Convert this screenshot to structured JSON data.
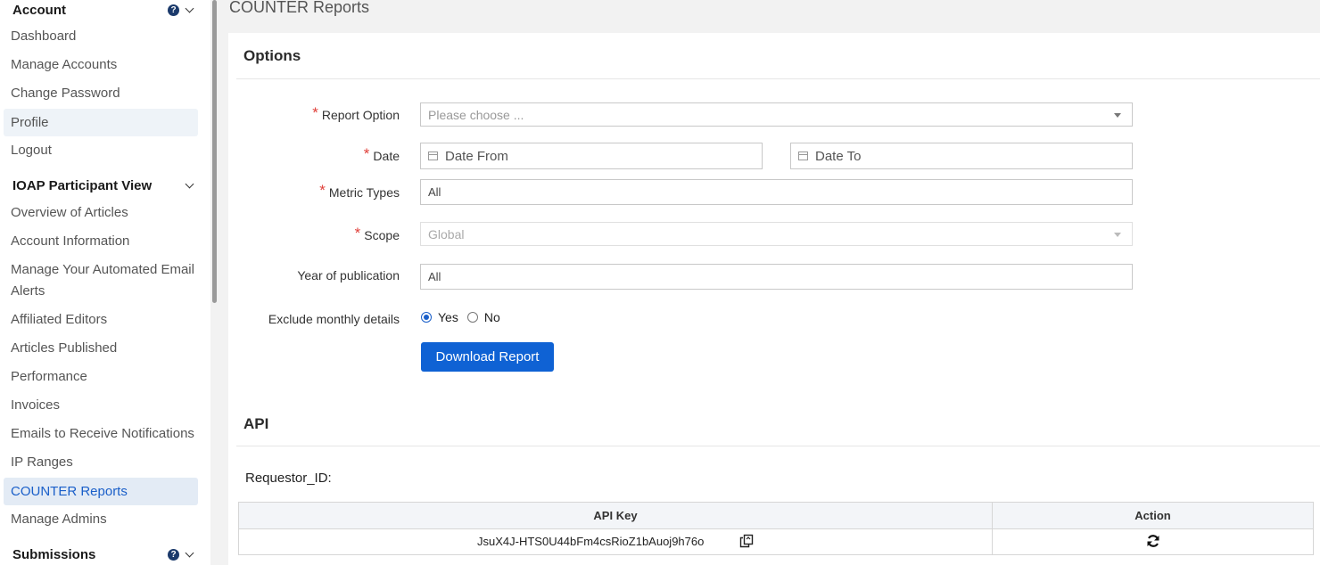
{
  "sidebar": {
    "account_header": "Account",
    "account_items": [
      "Dashboard",
      "Manage Accounts",
      "Change Password",
      "Profile",
      "Logout"
    ],
    "ioap_header": "IOAP Participant View",
    "ioap_items": [
      "Overview of Articles",
      "Account Information",
      "Manage Your Automated Email",
      "Alerts",
      "Affiliated Editors",
      "Articles Published",
      "Performance",
      "Invoices",
      "Emails to Receive Notifications",
      "IP Ranges",
      "COUNTER Reports",
      "Manage Admins"
    ],
    "submissions_header": "Submissions"
  },
  "page_title": "COUNTER Reports",
  "options": {
    "title": "Options",
    "report_option_label": "Report Option",
    "report_option_placeholder": "Please choose ...",
    "date_label": "Date",
    "date_from_placeholder": "Date From",
    "date_to_placeholder": "Date To",
    "metric_types_label": "Metric Types",
    "metric_types_value": "All",
    "scope_label": "Scope",
    "scope_value": "Global",
    "year_label": "Year of publication",
    "year_value": "All",
    "exclude_label": "Exclude monthly details",
    "yes_label": "Yes",
    "no_label": "No",
    "download_button": "Download Report"
  },
  "api": {
    "title": "API",
    "requestor_label": "Requestor_ID:",
    "col_api_key": "API Key",
    "col_action": "Action",
    "api_key_value": "JsuX4J-HTS0U44bFm4csRioZ1bAuoj9h76o"
  },
  "colors": {
    "accent": "#0f62d4",
    "required": "#e0403a",
    "active_bg": "#e3ebf5"
  }
}
